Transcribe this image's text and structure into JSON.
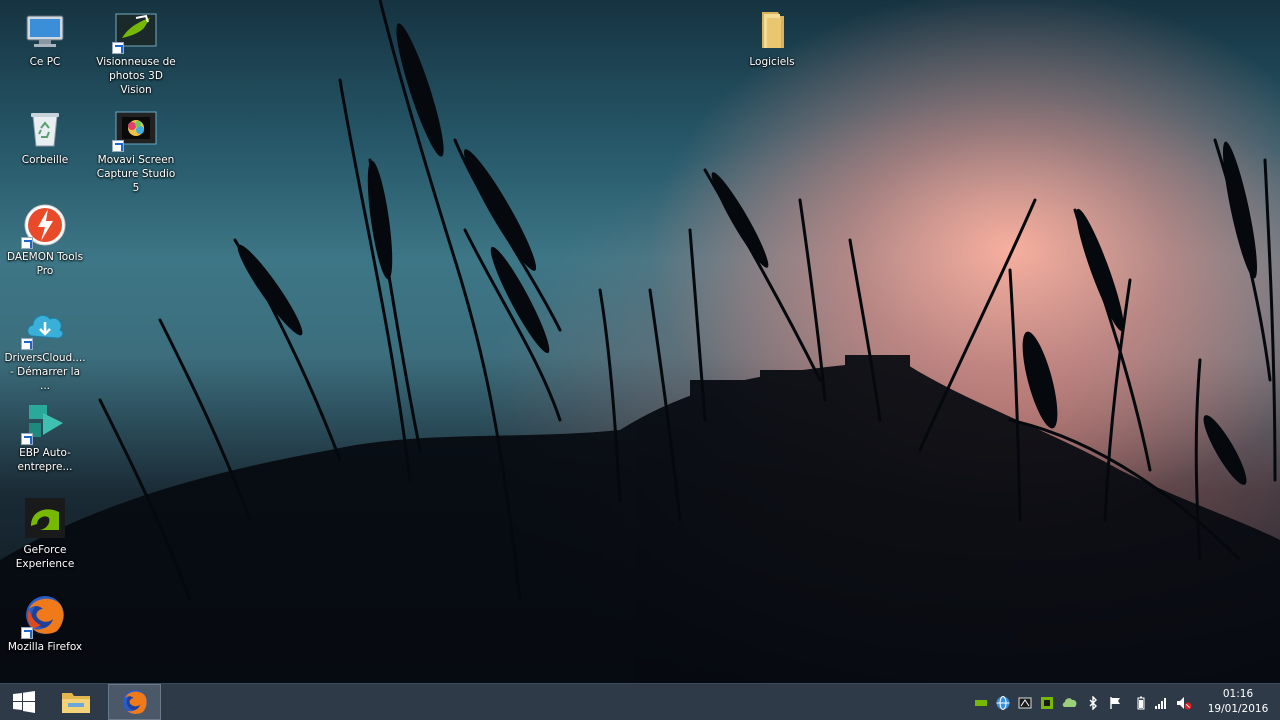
{
  "desktop_icons": [
    {
      "label": "Ce PC",
      "icon": "computer-icon"
    },
    {
      "label": "Visionneuse de photos 3D Vision",
      "icon": "photo-viewer-3d-icon"
    },
    {
      "label": "Logiciels",
      "icon": "folder-icon"
    },
    {
      "label": "Corbeille",
      "icon": "recycle-bin-icon"
    },
    {
      "label": "Movavi Screen Capture Studio 5",
      "icon": "movavi-icon"
    },
    {
      "label": "DAEMON Tools Pro",
      "icon": "daemon-tools-icon"
    },
    {
      "label": "DriversCloud.... - Démarrer la ...",
      "icon": "driverscloud-icon"
    },
    {
      "label": "EBP Auto-entrepre...",
      "icon": "ebp-icon"
    },
    {
      "label": "GeForce Experience",
      "icon": "geforce-icon"
    },
    {
      "label": "Mozilla Firefox",
      "icon": "firefox-icon"
    }
  ],
  "taskbar": {
    "start_icon": "windows-start-icon",
    "pinned": [
      {
        "name": "file-explorer",
        "icon": "folder-icon",
        "active": false
      },
      {
        "name": "firefox",
        "icon": "firefox-icon",
        "active": true
      }
    ],
    "tray_icons": [
      "nvidia-3d-icon",
      "network-globe-icon",
      "app-tray-icon",
      "geforce-tray-icon",
      "cloud-tray-icon",
      "bluetooth-icon",
      "action-center-flag-icon",
      "battery-icon",
      "signal-icon",
      "volume-muted-icon"
    ]
  },
  "clock": {
    "time": "01:16",
    "date": "19/01/2016"
  },
  "colors": {
    "taskbar": "#2e3a48",
    "accent": "#4a5868"
  }
}
